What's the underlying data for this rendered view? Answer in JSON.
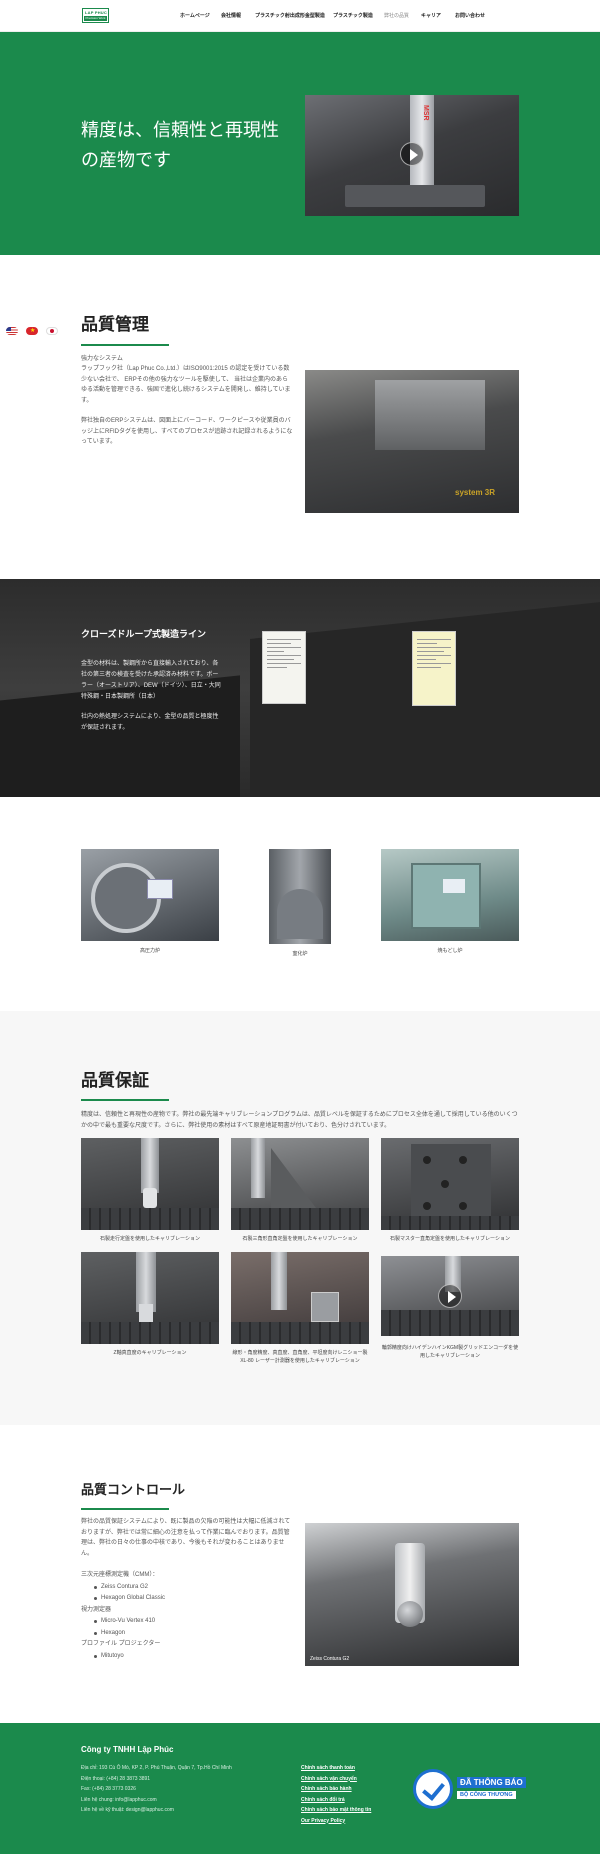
{
  "logo": {
    "line1": "LAP PHUC",
    "line2": "Precision Work"
  },
  "nav": {
    "items": [
      "ホームページ",
      "会社情報",
      "プラスチック射出成形金型製造",
      "プラスチック製造",
      "弊社の品質",
      "キャリア",
      "お問い合わせ"
    ],
    "active_index": 4
  },
  "flags": [
    "us-flag",
    "vn-flag",
    "jp-flag"
  ],
  "hero": {
    "title": "精度は、信頼性と再現性の産物です",
    "video_label": "MSR"
  },
  "quality_management": {
    "title": "品質管理",
    "subtitle": "強力なシステム",
    "para1": "ラップフック社（Lap Phuc Co.,Ltd.）はISO9001:2015 の認定を受けている数少ない会社で、 ERPその他の強力なツールを駆使して、 当社は企業内のあらゆる活動を管理できる、強固で進化し続けるシステムを開発し、維持しています。",
    "para2": "弊社独自のERPシステムは、図面上にバーコード、ワークピースや従業員のバッジ上にRFIDタグを使用し、すべてのプロセスが追跡され記録されるようになっています。",
    "photo_label": "system 3R"
  },
  "closed_loop": {
    "title": "クローズドループ式製造ライン",
    "para1": "金型の材料は、製鋼所から直接輸入されており、各社の第三者の検査を受けた承認済み材料です。ボーラー（オーストリア）、DEW（ドイツ）、日立・大同特殊鋼・日本製鋼所（日本）",
    "para2": "社内の熱処理システムにより、金型の品質と極度性が保証されます。"
  },
  "furnaces": [
    {
      "caption": "高圧力炉"
    },
    {
      "caption": "窒化炉"
    },
    {
      "caption": "焼もどし炉"
    }
  ],
  "quality_assurance": {
    "title": "品質保証",
    "intro": "精度は、信頼性と再現性の産物です。弊社の最先端キャリブレーションプログラムは、品質レベルを保証するためにプロセス全体を通して採用している他のいくつかの中で最も重要な尺度です。さらに、弊社使用の素材はすべて原産地証明書が付いており、色分けされています。",
    "items": [
      {
        "caption": "石製走行定盤を使用したキャリブレーション"
      },
      {
        "caption": "石製三角形直角定盤を使用したキャリブレーション"
      },
      {
        "caption": "石製マスター直角定盤を使用したキャリブレーション"
      },
      {
        "caption": "Z軸真直度のキャリブレーション"
      },
      {
        "caption": "線形・角度精度、真直度、直角度、平坦度向けレニショー製 XL-80 レーザー計測器を使用したキャリブレーション"
      },
      {
        "caption": "輪郭精度向けハイデンハインKGM製グリッドエンコーダを使用したキャリブレーション"
      }
    ]
  },
  "quality_control": {
    "title": "品質コントロール",
    "intro": "弊社の品質保証システムにより、既に製品の欠陥の可能性は大幅に低減されておりますが、弊社では常に細心の注意を払って作業に臨んでおります。品質管理は、弊社の日々の仕事の中核であり、今後もそれが変わることはありません。",
    "groups": [
      {
        "label": "三次元座標測定機（CMM）：",
        "items": [
          "Zeiss Contura G2",
          "Hexagon Global Classic"
        ]
      },
      {
        "label": "視力測定器",
        "items": [
          "Micro-Vu Vertex 410",
          "Hexagon"
        ]
      },
      {
        "label": "プロファイル プロジェクター",
        "items": [
          "Mitutoyo"
        ]
      }
    ],
    "photo_caption": "Zeiss Contura G2"
  },
  "footer": {
    "company": "Công ty TNHH Lập Phúc",
    "info": [
      "Địa chỉ: 193 Cù Ô Mò, KP 2, P. Phú Thuận, Quận 7, Tp.Hồ Chí Minh",
      "Điện thoại: (+84) 28 3873 3891",
      "Fax: (+84) 28 3773 0326",
      "Liên hệ chung: info@lapphuc.com",
      "Liên hệ về kỹ thuật: design@lapphuc.com"
    ],
    "links": [
      "Chính sách thanh toán",
      "Chính sách vận chuyển",
      "Chính sách bảo hành",
      "Chính sách đổi trả",
      "Chính sách bảo mật thông tin",
      "Our Privacy Policy"
    ],
    "badge_line1": "ĐÃ THÔNG BÁO",
    "badge_line2": "BỘ CÔNG THƯƠNG"
  },
  "colors": {
    "brand_green": "#1b8a4c",
    "badge_blue": "#1e6fd0"
  }
}
